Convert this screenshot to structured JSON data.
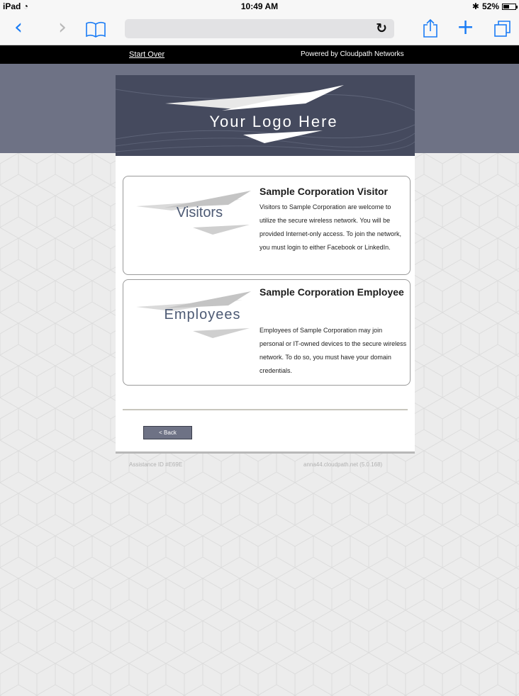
{
  "status_bar": {
    "device": "iPad",
    "time": "10:49 AM",
    "battery": "52%",
    "battery_level": 0.52
  },
  "toolbar": {
    "back_icon": "chevron-left-icon",
    "forward_icon": "chevron-right-icon",
    "bookmarks_icon": "book-icon",
    "reload_icon": "reload-icon",
    "share_icon": "share-icon",
    "new_tab_icon": "plus-icon",
    "tabs_icon": "tabs-icon"
  },
  "header": {
    "start_over": "Start Over",
    "powered_by": "Powered by Cloudpath Networks"
  },
  "logo": {
    "text": "Your Logo Here"
  },
  "options": [
    {
      "art_label": "Visitors",
      "title": "Sample Corporation Visitor",
      "description": "Visitors to Sample Corporation are welcome to utilize the secure wireless network. You will be provided Internet-only access. To join the network, you must login to either Facebook or LinkedIn."
    },
    {
      "art_label": "Employees",
      "title": "Sample Corporation Employee",
      "description": "Employees of Sample Corporation may join personal or IT-owned devices to the secure wireless network. To do so, you must have your domain credentials."
    }
  ],
  "back_button": "< Back",
  "footer": {
    "assistance_id": "Assistance ID #E69E",
    "server": "anna44.cloudpath.net (5.0.168)"
  },
  "colors": {
    "accent": "#1a7cf5",
    "band": "#6e7285",
    "logo_bg": "#454a5e",
    "art_text": "#4d5a74"
  }
}
